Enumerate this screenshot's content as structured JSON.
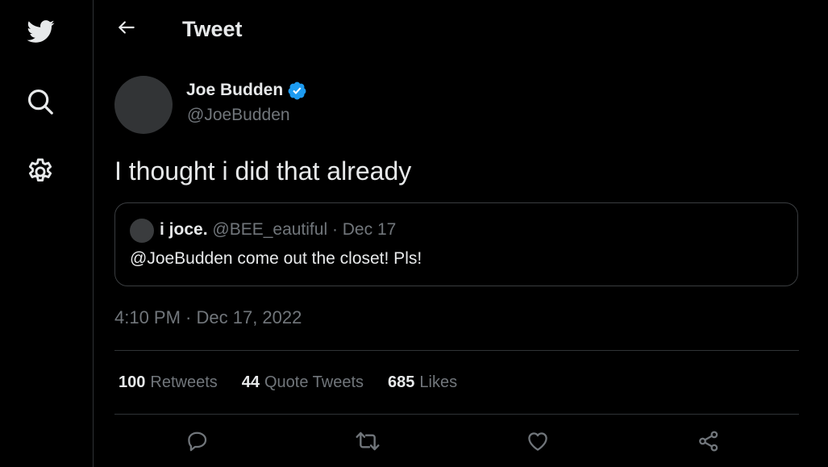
{
  "nav": {
    "icons": [
      "twitter-bird-icon",
      "search-icon",
      "settings-gear-icon"
    ]
  },
  "header": {
    "back_icon": "arrow-left-icon",
    "title": "Tweet"
  },
  "tweet": {
    "author_name": "Joe Budden",
    "author_handle": "@JoeBudden",
    "verified": true,
    "text": "I thought i did that already",
    "quote": {
      "author_name": "i joce.",
      "author_meta": "@BEE_eautiful · Dec 17",
      "text": "@JoeBudden come out the closet! Pls!"
    },
    "timestamp": "4:10 PM · Dec 17, 2022",
    "stats": {
      "retweets_count": "100",
      "retweets_label": "Retweets",
      "quotes_count": "44",
      "quotes_label": "Quote Tweets",
      "likes_count": "685",
      "likes_label": "Likes"
    },
    "actions": [
      "reply-icon",
      "retweet-icon",
      "like-icon",
      "share-icon"
    ]
  },
  "colors": {
    "background": "#000000",
    "text_primary": "#e7e9ea",
    "text_secondary": "#71767b",
    "border": "#2f3336",
    "verified_blue": "#1d9bf0"
  }
}
